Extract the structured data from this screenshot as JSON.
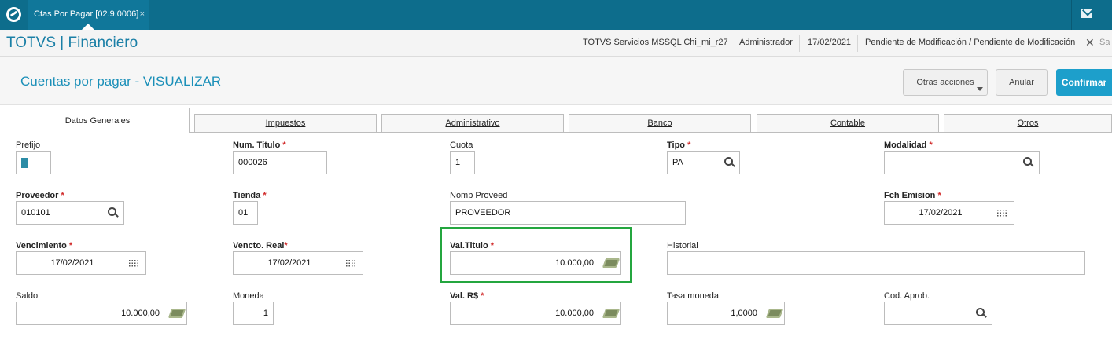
{
  "topbar": {
    "tab_title": "Ctas Por Pagar [02.9.0006]",
    "tab_close": "×"
  },
  "header": {
    "app_title": "TOTVS | Financiero",
    "environment": "TOTVS Servicios MSSQL Chi_mi_r27",
    "user": "Administrador",
    "date": "17/02/2021",
    "status": "Pendiente de Modificación / Pendiente de Modificación",
    "close_label": "✕",
    "exit_label": "Sa"
  },
  "page": {
    "title": "Cuentas por pagar - VISUALIZAR",
    "other_actions_label": "Otras acciones",
    "cancel_label": "Anular",
    "confirm_label": "Confirmar"
  },
  "tabs": [
    {
      "label": "Datos Generales"
    },
    {
      "label": "Impuestos"
    },
    {
      "label": "Administrativo"
    },
    {
      "label": "Banco"
    },
    {
      "label": "Contable"
    },
    {
      "label": "Otros"
    }
  ],
  "fields": {
    "prefijo": {
      "label": "Prefijo",
      "value": ""
    },
    "num_titulo": {
      "label": "Num. Titulo",
      "req": "*",
      "value": "000026"
    },
    "cuota": {
      "label": "Cuota",
      "value": "1"
    },
    "tipo": {
      "label": "Tipo",
      "req": "*",
      "value": "PA"
    },
    "modalidad": {
      "label": "Modalidad",
      "req": "*",
      "value": ""
    },
    "proveedor": {
      "label": "Proveedor",
      "req": "*",
      "value": "010101"
    },
    "tienda": {
      "label": "Tienda",
      "req": "*",
      "value": "01"
    },
    "nomb_proveed": {
      "label": "Nomb Proveed",
      "value": "PROVEEDOR"
    },
    "fch_emision": {
      "label": "Fch Emision",
      "req": "*",
      "value": "17/02/2021"
    },
    "vencimiento": {
      "label": "Vencimiento",
      "req": "*",
      "value": "17/02/2021"
    },
    "vencto_real": {
      "label": "Vencto. Real",
      "req": "*",
      "value": "17/02/2021"
    },
    "val_titulo": {
      "label": "Val.Titulo",
      "req": "*",
      "value": "10.000,00"
    },
    "historial": {
      "label": "Historial",
      "value": ""
    },
    "saldo": {
      "label": "Saldo",
      "value": "10.000,00"
    },
    "moneda": {
      "label": "Moneda",
      "value": "1"
    },
    "val_rs": {
      "label": "Val. R$",
      "req": "*",
      "value": "10.000,00"
    },
    "tasa_moneda": {
      "label": "Tasa moneda",
      "value": "1,0000"
    },
    "cod_aprob": {
      "label": "Cod. Aprob.",
      "value": ""
    }
  },
  "colors": {
    "topbar": "#0d6d8c",
    "accent": "#1a8fb8",
    "primary_button": "#1d9fcb",
    "required": "#d12b2b",
    "highlight": "#24a63f"
  }
}
